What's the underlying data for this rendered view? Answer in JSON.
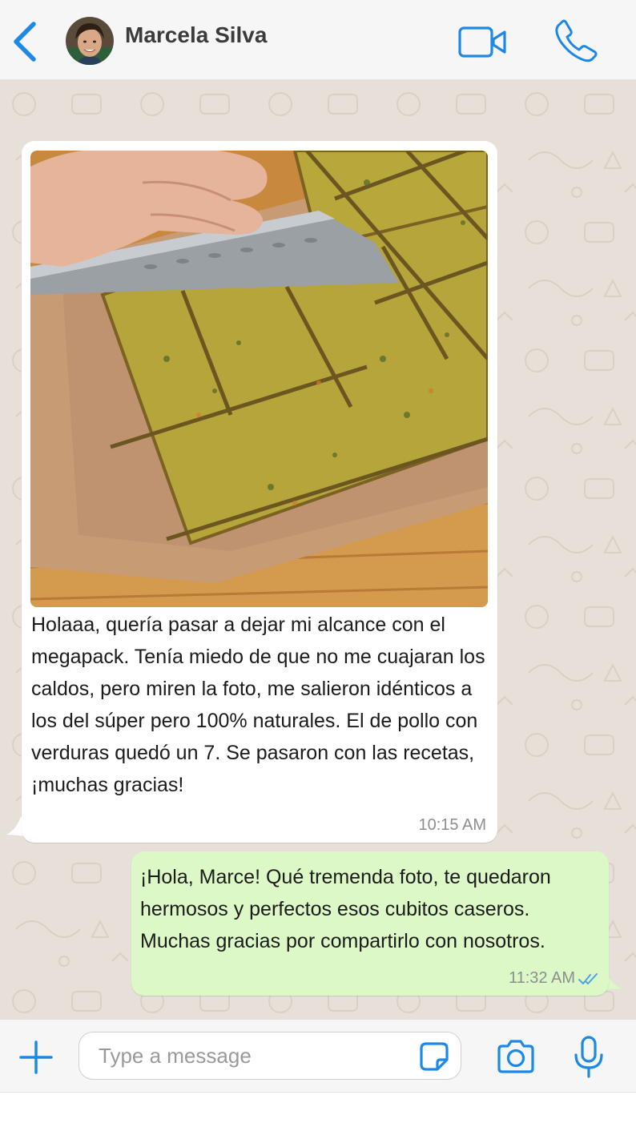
{
  "header": {
    "contact_name": "Marcela Silva",
    "back_icon": "chevron-left-icon",
    "video_icon": "video-camera-icon",
    "call_icon": "phone-icon"
  },
  "messages": [
    {
      "direction": "incoming",
      "has_photo": true,
      "photo_description_icon": "food-photo",
      "text": "Holaaa, quería pasar a dejar mi alcance con el megapack. Tenía miedo de que no me cuajaran los caldos, pero miren la foto, me salieron idénticos a los del súper pero 100% naturales. El de pollo con verduras quedó un 7. Se pasaron con las recetas, ¡muchas gracias!",
      "time": "10:15 AM"
    },
    {
      "direction": "outgoing",
      "text": "¡Hola, Marce! Qué tremenda foto, te quedaron hermosos y perfectos esos cubitos caseros. Muchas gracias por compartirlo con nosotros.",
      "time": "11:32 AM",
      "status": "read"
    }
  ],
  "composer": {
    "placeholder": "Type a message",
    "value": ""
  },
  "colors": {
    "accent": "#1e88e5",
    "chat_background": "#e7e0d8",
    "outgoing_bubble": "#dcf8c6",
    "incoming_bubble": "#ffffff",
    "read_ticks": "#4fa3e0"
  }
}
